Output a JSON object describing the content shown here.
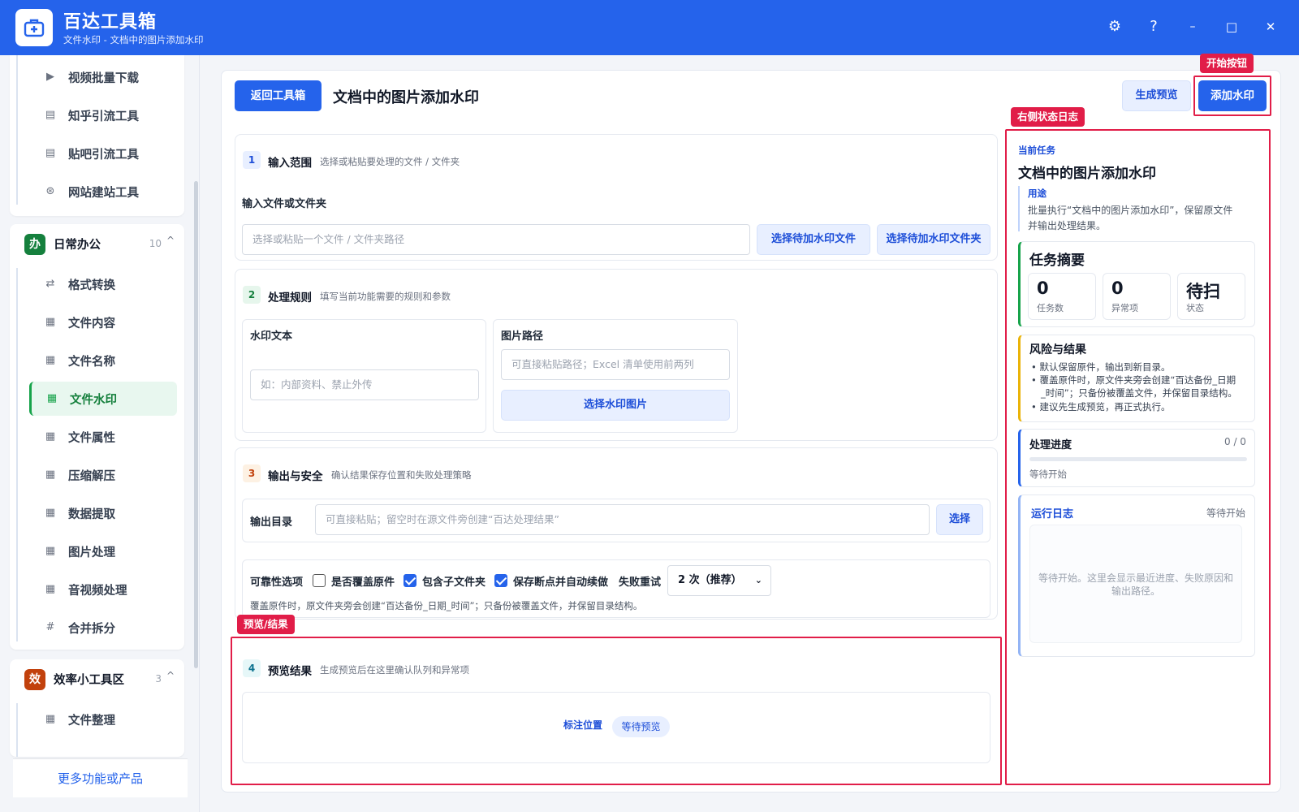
{
  "app": {
    "title": "百达工具箱",
    "subtitle": "文件水印 - 文档中的图片添加水印"
  },
  "window": {
    "settings": "⚙",
    "help": "?",
    "minimize": "–",
    "maximize": "□",
    "close": "✕"
  },
  "sidebar": {
    "top_items": [
      {
        "label": "视频批量下载",
        "icon": "video-icon"
      },
      {
        "label": "知乎引流工具",
        "icon": "doc-icon"
      },
      {
        "label": "贴吧引流工具",
        "icon": "doc-icon"
      },
      {
        "label": "网站建站工具",
        "icon": "globe-icon"
      }
    ],
    "group_office": {
      "badge": "办",
      "badge_color": "#15803d",
      "title": "日常办公",
      "count": "10",
      "chevron": "^",
      "items": [
        {
          "label": "格式转换",
          "icon": "⇄"
        },
        {
          "label": "文件内容",
          "icon": "▦"
        },
        {
          "label": "文件名称",
          "icon": "▦"
        },
        {
          "label": "文件水印",
          "icon": "▦",
          "active": true
        },
        {
          "label": "文件属性",
          "icon": "▦"
        },
        {
          "label": "压缩解压",
          "icon": "▦"
        },
        {
          "label": "数据提取",
          "icon": "▦"
        },
        {
          "label": "图片处理",
          "icon": "▦"
        },
        {
          "label": "音视频处理",
          "icon": "▦"
        },
        {
          "label": "合并拆分",
          "icon": "#"
        }
      ]
    },
    "group_efficiency": {
      "badge": "效",
      "badge_color": "#c2410c",
      "title": "效率小工具区",
      "count": "3",
      "chevron": "^",
      "items": [
        {
          "label": "文件整理",
          "icon": "▦"
        }
      ]
    },
    "more_link": "更多功能或产品"
  },
  "header": {
    "back_button": "返回工具箱",
    "page_title": "文档中的图片添加水印",
    "preview_button": "生成预览",
    "start_button": "添加水印"
  },
  "annotations": {
    "start": "开始按钮",
    "log": "右侧状态日志",
    "preview": "预览/结果"
  },
  "step1": {
    "num": "1",
    "title": "输入范围",
    "desc": "选择或粘贴要处理的文件 / 文件夹",
    "field_label": "输入文件或文件夹",
    "placeholder": "选择或粘贴一个文件 / 文件夹路径",
    "btn_file": "选择待加水印文件",
    "btn_folder": "选择待加水印文件夹"
  },
  "step2": {
    "num": "2",
    "title": "处理规则",
    "desc": "填写当前功能需要的规则和参数",
    "watermark_label": "水印文本",
    "watermark_placeholder": "如：内部资料、禁止外传",
    "image_label": "图片路径",
    "image_placeholder": "可直接粘贴路径；Excel 清单使用前两列",
    "image_button": "选择水印图片"
  },
  "step3": {
    "num": "3",
    "title": "输出与安全",
    "desc": "确认结果保存位置和失败处理策略",
    "output_label": "输出目录",
    "output_placeholder": "可直接粘贴；留空时在源文件旁创建“百达处理结果”",
    "choose_button": "选择",
    "reliability_label": "可靠性选项",
    "opt_overwrite": "是否覆盖原件",
    "opt_subfolder": "包含子文件夹",
    "opt_resume": "保存断点并自动续做",
    "retry_label": "失败重试",
    "retry_value": "2 次（推荐）",
    "hint": "覆盖原件时，原文件夹旁会创建“百达备份_日期_时间”；只备份被覆盖文件，并保留目录结构。"
  },
  "step4": {
    "num": "4",
    "title": "预览结果",
    "desc": "生成预览后在这里确认队列和异常项",
    "mark_pos": "标注位置",
    "status": "等待预览"
  },
  "right": {
    "current_label": "当前任务",
    "current_title": "文档中的图片添加水印",
    "purpose_label": "用途",
    "purpose_text_1": "批量执行“文档中的图片添加水印”，保留原文件",
    "purpose_text_2": "并输出处理结果。",
    "summary_title": "任务摘要",
    "stats": [
      {
        "num": "0",
        "cap": "任务数"
      },
      {
        "num": "0",
        "cap": "异常项"
      },
      {
        "num": "待扫",
        "cap": "状态"
      }
    ],
    "risk_title": "风险与结果",
    "risk_1": "默认保留原件，输出到新目录。",
    "risk_2a": "覆盖原件时，原文件夹旁会创建“百达备份_日期",
    "risk_2b": "_时间”；只备份被覆盖文件，并保留目录结构。",
    "risk_3": "建议先生成预览，再正式执行。",
    "progress_title": "处理进度",
    "progress_count": "0 / 0",
    "progress_value": 0,
    "progress_status": "等待开始",
    "log_title": "运行日志",
    "log_status": "等待开始",
    "log_text_1": "等待开始。这里会显示最近进度、失败原因和",
    "log_text_2": "输出路径。"
  },
  "colors": {
    "primary": "#2563eb",
    "annotation": "#e11d48",
    "office_green": "#15803d",
    "efficiency_orange": "#c2410c"
  }
}
